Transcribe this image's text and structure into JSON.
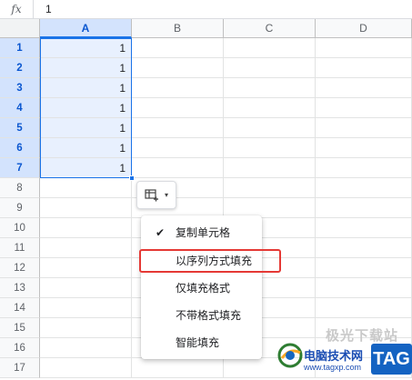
{
  "formula_bar": {
    "fx_label": "fx",
    "value": "1"
  },
  "columns": [
    "A",
    "B",
    "C",
    "D"
  ],
  "rows": [
    "1",
    "2",
    "3",
    "4",
    "5",
    "6",
    "7",
    "8",
    "9",
    "10",
    "11",
    "12",
    "13",
    "14",
    "15",
    "16",
    "17"
  ],
  "cells_A": [
    "1",
    "1",
    "1",
    "1",
    "1",
    "1",
    "1"
  ],
  "menu": {
    "items": [
      {
        "label": "复制单元格",
        "checked": true
      },
      {
        "label": "以序列方式填充",
        "checked": false
      },
      {
        "label": "仅填充格式",
        "checked": false
      },
      {
        "label": "不带格式填充",
        "checked": false
      },
      {
        "label": "智能填充",
        "checked": false
      }
    ],
    "check_glyph": "✔"
  },
  "paste_options": {
    "icon": "paste-options-icon",
    "caret": "▾"
  },
  "watermark": {
    "top_text": "极光下载站",
    "name": "电脑技术网",
    "url": "www.tagxp.com",
    "tag": "TAG"
  },
  "colors": {
    "accent": "#1a73e8",
    "highlight_border": "#e53935",
    "selection_fill": "#e8f0fe"
  }
}
